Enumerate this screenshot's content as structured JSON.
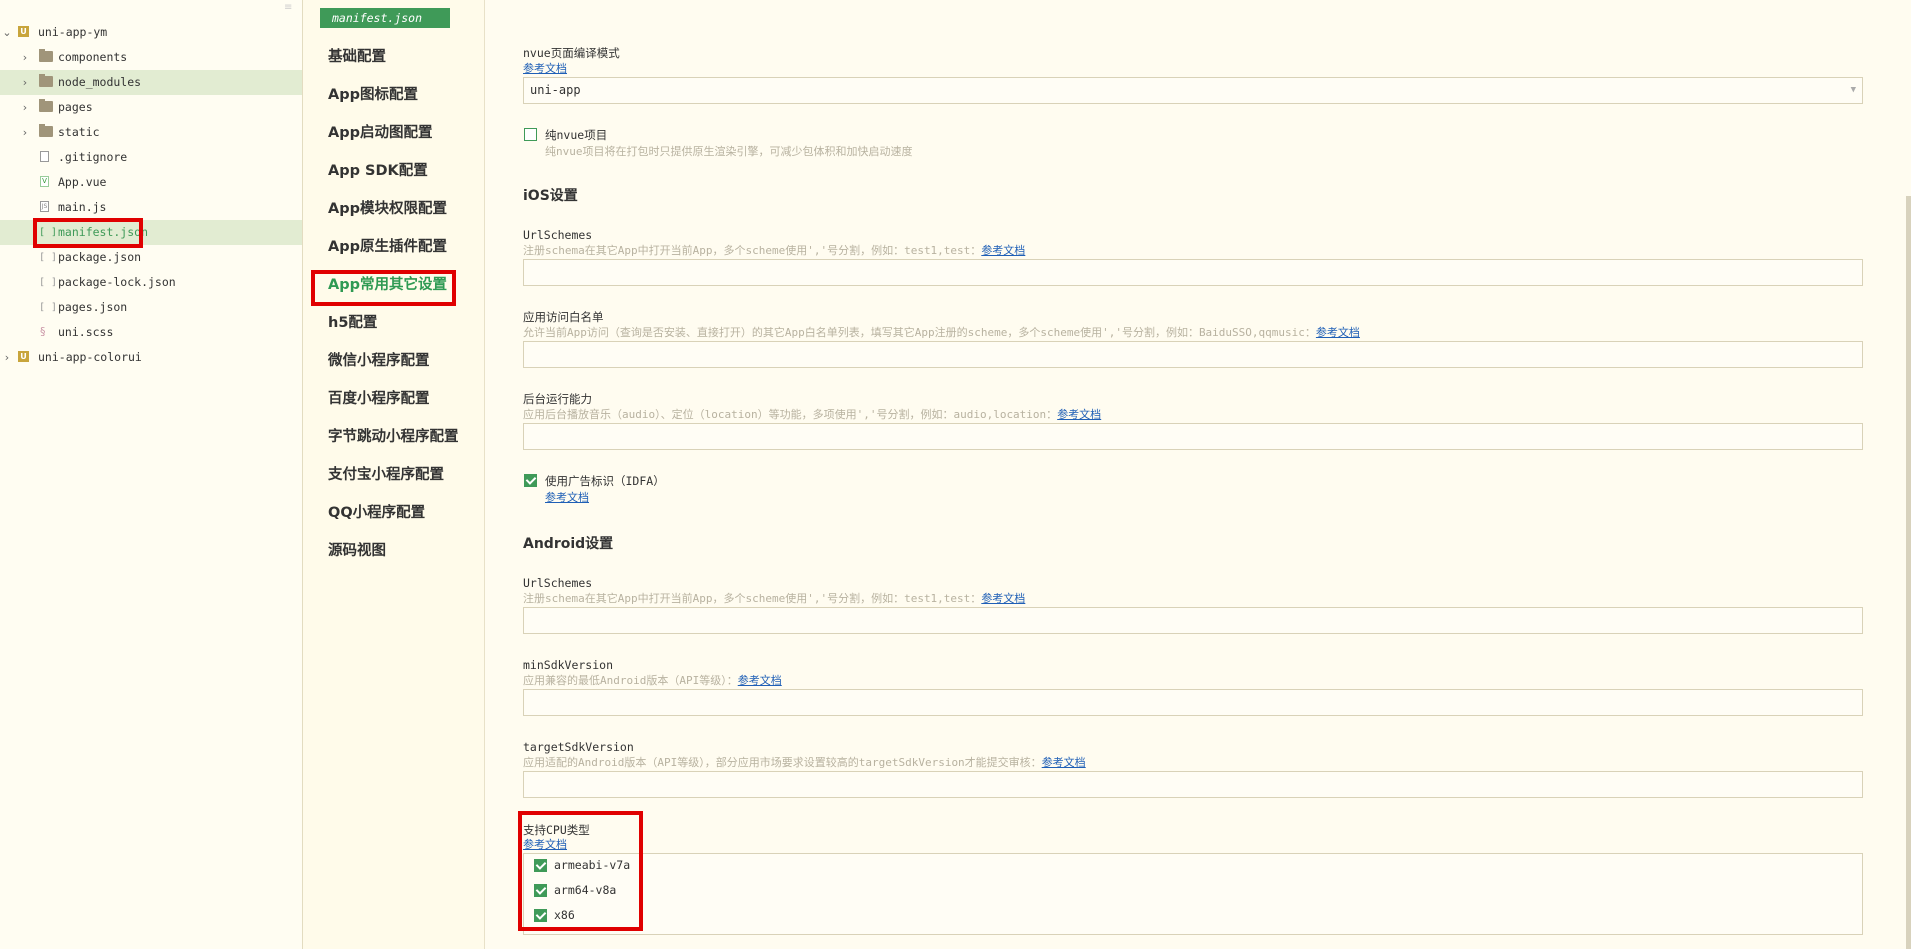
{
  "explorer": {
    "items": [
      {
        "label": "uni-app-ym",
        "icon": "project-icon",
        "chevron": "⌄"
      },
      {
        "label": "components",
        "icon": "folder-icon",
        "chevron": "›"
      },
      {
        "label": "node_modules",
        "icon": "folder-icon",
        "chevron": "›"
      },
      {
        "label": "pages",
        "icon": "folder-icon",
        "chevron": "›"
      },
      {
        "label": "static",
        "icon": "folder-icon",
        "chevron": "›"
      },
      {
        "label": ".gitignore",
        "icon": "file-icon"
      },
      {
        "label": "App.vue",
        "icon": "vue-file-icon"
      },
      {
        "label": "main.js",
        "icon": "js-file-icon"
      },
      {
        "label": "manifest.json",
        "icon": "json-file-icon"
      },
      {
        "label": "package.json",
        "icon": "json-file-icon"
      },
      {
        "label": "package-lock.json",
        "icon": "json-file-icon"
      },
      {
        "label": "pages.json",
        "icon": "json-file-icon"
      },
      {
        "label": "uni.scss",
        "icon": "scss-file-icon"
      },
      {
        "label": "uni-app-colorui",
        "icon": "project-icon",
        "chevron": "›"
      }
    ]
  },
  "editor": {
    "tab_label": "manifest.json"
  },
  "nav": {
    "items": [
      "基础配置",
      "App图标配置",
      "App启动图配置",
      "App SDK配置",
      "App模块权限配置",
      "App原生插件配置",
      "App常用其它设置",
      "h5配置",
      "微信小程序配置",
      "百度小程序配置",
      "字节跳动小程序配置",
      "支付宝小程序配置",
      "QQ小程序配置",
      "源码视图"
    ],
    "active_index": 6
  },
  "form": {
    "ref_link": "参考文档",
    "nvue_mode": {
      "label": "nvue页面编译模式",
      "value": "uni-app"
    },
    "pure_nvue": {
      "label": "纯nvue项目",
      "desc": "纯nvue项目将在打包时只提供原生渲染引擎，可减少包体积和加快启动速度",
      "checked": false
    },
    "ios": {
      "title": "iOS设置",
      "url_schemes": {
        "label": "UrlSchemes",
        "desc": "注册schema在其它App中打开当前App，多个scheme使用','号分割，例如：test1,test：",
        "value": ""
      },
      "whitelist": {
        "label": "应用访问白名单",
        "desc": "允许当前App访问（查询是否安装、直接打开）的其它App白名单列表，填写其它App注册的scheme，多个scheme使用','号分割，例如：BaiduSSO,qqmusic：",
        "value": ""
      },
      "background": {
        "label": "后台运行能力",
        "desc": "应用后台播放音乐（audio）、定位（location）等功能，多项使用','号分割，例如：audio,location：",
        "value": ""
      },
      "idfa": {
        "label": "使用广告标识（IDFA）",
        "checked": true
      }
    },
    "android": {
      "title": "Android设置",
      "url_schemes": {
        "label": "UrlSchemes",
        "desc": "注册schema在其它App中打开当前App，多个scheme使用','号分割，例如：test1,test：",
        "value": ""
      },
      "min_sdk": {
        "label": "minSdkVersion",
        "desc": "应用兼容的最低Android版本（API等级）：",
        "value": ""
      },
      "target_sdk": {
        "label": "targetSdkVersion",
        "desc": "应用适配的Android版本（API等级），部分应用市场要求设置较高的targetSdkVersion才能提交审核：",
        "value": ""
      },
      "cpu": {
        "label": "支持CPU类型",
        "options": [
          {
            "label": "armeabi-v7a",
            "checked": true
          },
          {
            "label": "arm64-v8a",
            "checked": true
          },
          {
            "label": "x86",
            "checked": true
          }
        ]
      }
    }
  },
  "colors": {
    "accent": "#3f9a58",
    "highlight": "#e00000",
    "link": "#1f5fb6",
    "background": "#fffcf0"
  }
}
